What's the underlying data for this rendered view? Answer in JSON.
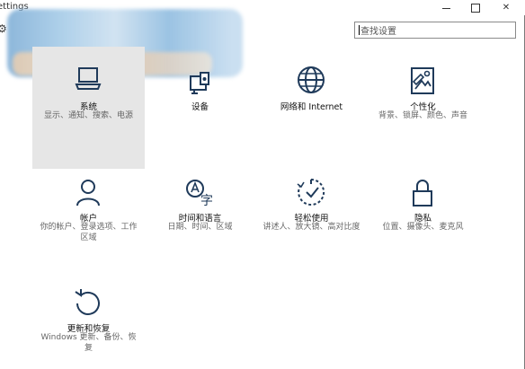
{
  "window": {
    "title": "ettings"
  },
  "search": {
    "value": "查找设置",
    "placeholder": "查找设置"
  },
  "tiles": [
    {
      "id": "system",
      "label": "系统",
      "description": "显示、通知、搜索、电源",
      "icon": "laptop-icon"
    },
    {
      "id": "devices",
      "label": "设备",
      "description": "",
      "icon": "devices-icon"
    },
    {
      "id": "network",
      "label": "网络和 Internet",
      "description": "",
      "icon": "globe-icon"
    },
    {
      "id": "personalization",
      "label": "个性化",
      "description": "背景、锁屏、颜色、声音",
      "icon": "personalize-icon"
    },
    {
      "id": "accounts",
      "label": "帐户",
      "description": "你的帐户、登录选项、工作区域",
      "icon": "person-icon"
    },
    {
      "id": "time_language",
      "label": "时间和语言",
      "description": "日期、时间、区域",
      "icon": "time-language-icon"
    },
    {
      "id": "ease_of_access",
      "label": "轻松使用",
      "description": "讲述人、放大镜、高对比度",
      "icon": "ease-access-icon"
    },
    {
      "id": "privacy",
      "label": "隐私",
      "description": "位置、摄像头、麦克风",
      "icon": "lock-icon"
    },
    {
      "id": "update_security",
      "label": "更新和恢复",
      "description": "Windows 更新、备份、恢复",
      "icon": "update-icon"
    }
  ],
  "colors": {
    "icon": "#1f3a5a",
    "selected_tile": "#e6e6e6"
  }
}
